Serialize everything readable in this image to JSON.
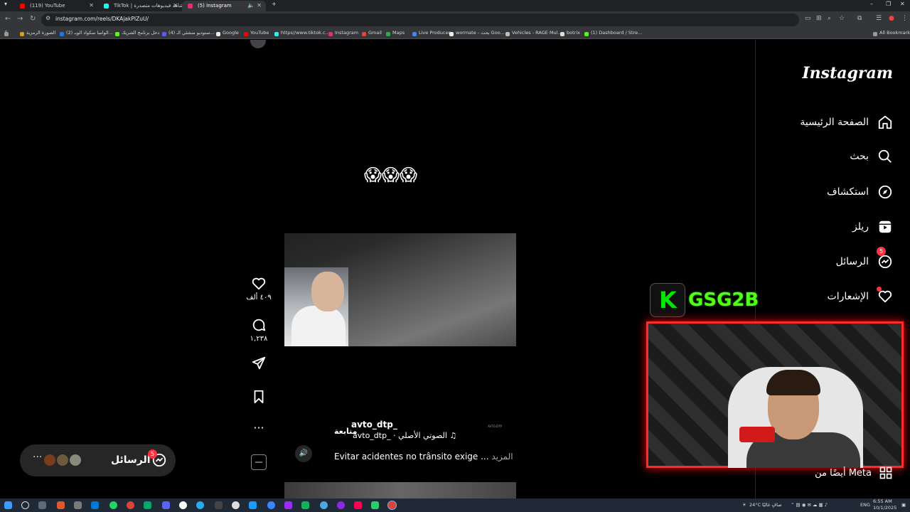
{
  "browser": {
    "tabs": [
      {
        "title": "(119) YouTube",
        "color": "#ff0000"
      },
      {
        "title": "TikTok | شاهد فيديوهات متصدرة",
        "color": "#25f4ee"
      },
      {
        "title": "(5) Instagram",
        "color": "#e1306c"
      }
    ],
    "url": "instagram.com/reels/DKAjakPIZuU/",
    "bookmarks": [
      {
        "label": "الصورة الرمزية",
        "color": "#d4a017"
      },
      {
        "label": "(2) الوامبا سكواد الوبـ...",
        "color": "#1877f2"
      },
      {
        "label": "دخل برنامج الشريك",
        "color": "#53fc18"
      },
      {
        "label": "(4) ستوديو منشئي الـ...",
        "color": "#5a5aff"
      },
      {
        "label": "Google",
        "color": "#eeeeee"
      },
      {
        "label": "YouTube",
        "color": "#ff0000"
      },
      {
        "label": "https//www.tiktok.c...",
        "color": "#25f4ee"
      },
      {
        "label": "Instagram",
        "color": "#e1306c"
      },
      {
        "label": "Gmail",
        "color": "#ea4335"
      },
      {
        "label": "Maps",
        "color": "#34a853"
      },
      {
        "label": "Live Producer",
        "color": "#4285f4"
      },
      {
        "label": "wormate - بحث Goo...",
        "color": "#eeeeee"
      },
      {
        "label": "Vehicles - RAGE Mul...",
        "color": "#bbbbbb"
      },
      {
        "label": "botrix",
        "color": "#dddddd"
      },
      {
        "label": "(1) Dashboard / Stre...",
        "color": "#53fc18"
      }
    ],
    "all_bookmarks": "All Bookmarks"
  },
  "instagram": {
    "logo": "Instagram",
    "nav": [
      {
        "label": "الصفحة الرئيسية",
        "icon": "home-icon"
      },
      {
        "label": "بحث",
        "icon": "search-icon"
      },
      {
        "label": "استكشاف",
        "icon": "explore-icon"
      },
      {
        "label": "ريلز",
        "icon": "reels-icon"
      },
      {
        "label": "الرسائل",
        "icon": "messenger-icon",
        "badge": "5"
      },
      {
        "label": "الإشعارات",
        "icon": "heart-icon"
      }
    ],
    "also_from_meta": "أيضًا من Meta",
    "reel": {
      "emoji": "😱😱😱",
      "likes": "٤٠٩ ألف",
      "comments": "١,٢٣٨",
      "author": "avto_dtp_",
      "follow": "متابعة",
      "audio": "avto_dtp_ · الصوتي الأصلي ♫",
      "caption": "Evitar acidentes no trânsito exige ...",
      "more": "المزيد"
    },
    "messages": {
      "label": "الرسائل",
      "badge": "5",
      "more": "···"
    }
  },
  "stream": {
    "brand_letter": "K",
    "brand_name": "GSG2B"
  },
  "taskbar": {
    "weather": "24°C",
    "weather_desc": "صافٍ غالبًا",
    "lang": "ENG",
    "time": "6:55 AM",
    "date": "10/1/2025"
  }
}
